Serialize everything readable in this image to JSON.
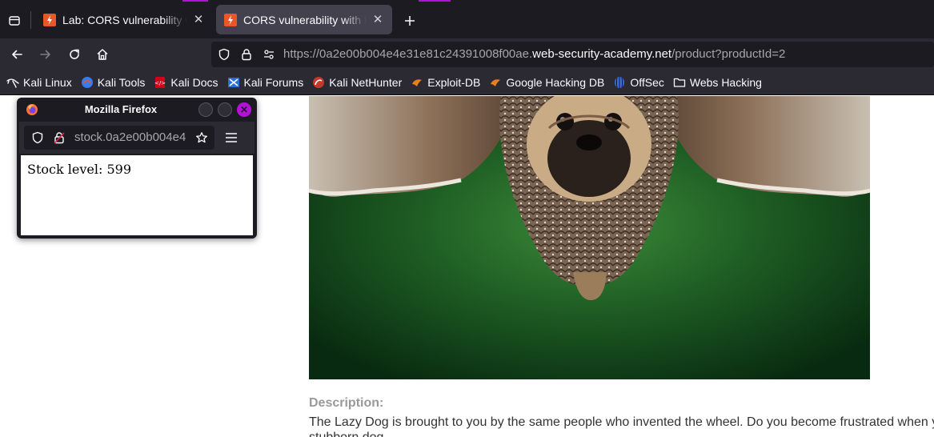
{
  "browser": {
    "accent_color": "#b312d6",
    "tabs": [
      {
        "title": "Lab: CORS vulnerability with trusted insecure protocols",
        "favicon": "portswigger-icon",
        "active": false
      },
      {
        "title": "CORS vulnerability with trusted insecure protocols",
        "favicon": "portswigger-icon",
        "active": true
      }
    ],
    "url": {
      "prefix": "https://0a2e00b004e4e31e81c24391008f00ae.",
      "host": "web-security-academy.net",
      "path": "/product?productId=2"
    },
    "bookmarks": [
      {
        "label": "Kali Linux",
        "icon": "kali-dragon-icon"
      },
      {
        "label": "Kali Tools",
        "icon": "kali-tools-icon"
      },
      {
        "label": "Kali Docs",
        "icon": "kali-docs-icon"
      },
      {
        "label": "Kali Forums",
        "icon": "kali-forums-icon"
      },
      {
        "label": "Kali NetHunter",
        "icon": "nethunter-icon"
      },
      {
        "label": "Exploit-DB",
        "icon": "exploit-db-icon"
      },
      {
        "label": "Google Hacking DB",
        "icon": "ghdb-icon"
      },
      {
        "label": "OffSec",
        "icon": "offsec-icon"
      },
      {
        "label": "Webs Hacking",
        "icon": "folder-icon"
      }
    ]
  },
  "popup": {
    "title": "Mozilla Firefox",
    "url": "stock.0a2e00b004e4",
    "body_text": "Stock level: 599"
  },
  "page": {
    "description_heading": "Description:",
    "description_line1": "The Lazy Dog is brought to you by the same people who invented the wheel. Do you become frustrated when y",
    "description_line2": "stubborn dog"
  }
}
